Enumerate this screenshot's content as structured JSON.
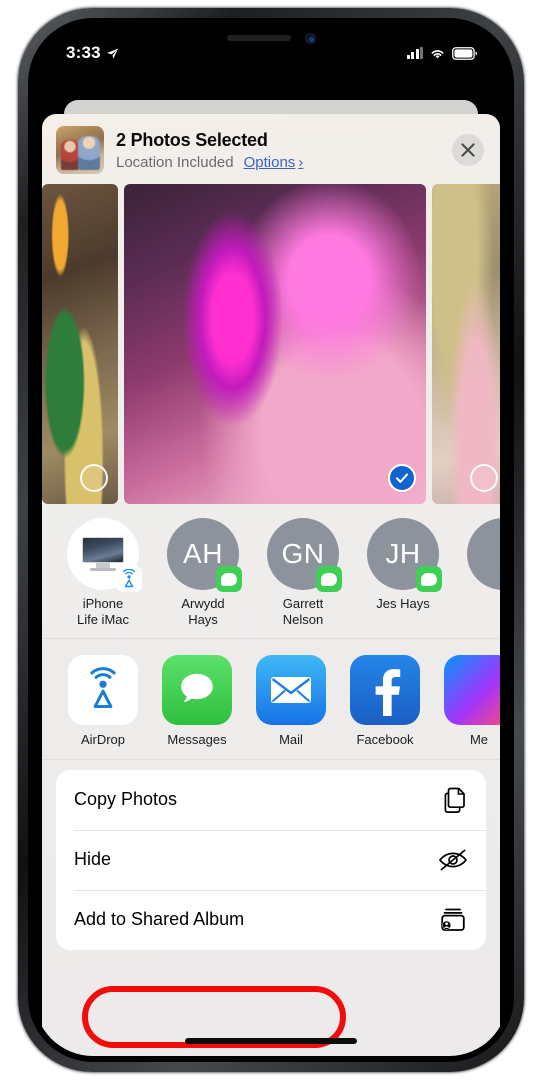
{
  "status_bar": {
    "time": "3:33",
    "location_arrow_icon": "location-arrow-icon",
    "cellular_icon": "cellular-bars-icon",
    "wifi_icon": "wifi-icon",
    "battery_icon": "battery-icon"
  },
  "share_sheet": {
    "title": "2 Photos Selected",
    "location_note": "Location Included",
    "options_label": "Options",
    "options_chevron": "›",
    "close_icon": "close-icon",
    "thumbnail_name": "selected-photo-thumbnail"
  },
  "photos": [
    {
      "name": "photo-left-partial",
      "selected": false,
      "art": "ph-1",
      "size": "edge"
    },
    {
      "name": "photo-center",
      "selected": true,
      "art": "ph-2",
      "size": "center"
    },
    {
      "name": "photo-right-partial",
      "selected": false,
      "art": "ph-3",
      "size": "edge"
    }
  ],
  "contacts": [
    {
      "label_line1": "iPhone",
      "label_line2": "Life iMac",
      "initials": "",
      "type": "device",
      "badge": "airdrop"
    },
    {
      "label_line1": "Arwydd",
      "label_line2": "Hays",
      "initials": "AH",
      "type": "person",
      "badge": "messages"
    },
    {
      "label_line1": "Garrett",
      "label_line2": "Nelson",
      "initials": "GN",
      "type": "person",
      "badge": "messages"
    },
    {
      "label_line1": "Jes Hays",
      "label_line2": "",
      "initials": "JH",
      "type": "person",
      "badge": "messages"
    },
    {
      "label_line1": "",
      "label_line2": "",
      "initials": "",
      "type": "person",
      "badge": "messages"
    }
  ],
  "apps": [
    {
      "label": "AirDrop",
      "icon": "airdrop-icon"
    },
    {
      "label": "Messages",
      "icon": "messages-icon"
    },
    {
      "label": "Mail",
      "icon": "mail-icon"
    },
    {
      "label": "Facebook",
      "icon": "facebook-icon"
    },
    {
      "label": "Me",
      "icon": "messenger-icon"
    }
  ],
  "actions": [
    {
      "label": "Copy Photos",
      "icon": "copy-icon"
    },
    {
      "label": "Hide",
      "icon": "eye-slash-icon"
    },
    {
      "label": "Add to Shared Album",
      "icon": "shared-album-icon",
      "highlighted": true
    }
  ],
  "annotation": {
    "highlight_color": "#f20d0d",
    "target": "Add to Shared Album"
  },
  "colors": {
    "selected_check": "#1064cf",
    "link_blue": "#3a64c8",
    "messages_green": "#3ed055",
    "sheet_background": "#efeeec"
  }
}
